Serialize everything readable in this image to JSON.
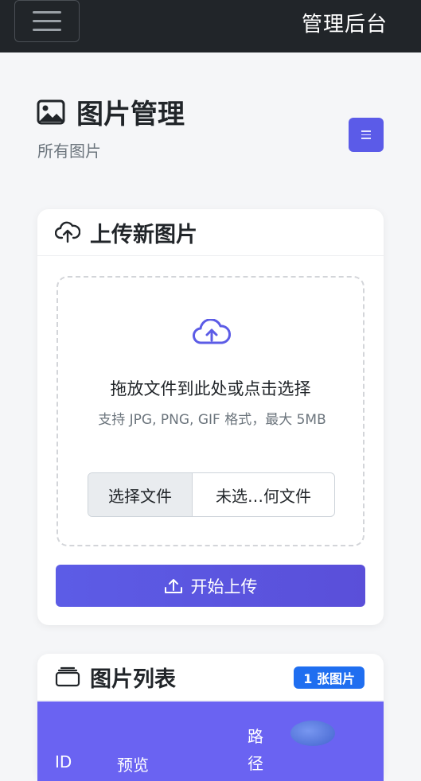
{
  "navbar": {
    "brand": "管理后台"
  },
  "header": {
    "title": "图片管理",
    "subtitle": "所有图片"
  },
  "upload_card": {
    "title": "上传新图片",
    "dropzone_title": "拖放文件到此处或点击选择",
    "dropzone_hint": "支持 JPG, PNG, GIF 格式，最大 5MB",
    "choose_file_label": "选择文件",
    "file_status": "未选…何文件",
    "upload_button": "开始上传"
  },
  "list_card": {
    "title": "图片列表",
    "count_badge": "1 张图片",
    "columns": [
      "ID",
      "预览",
      "路径"
    ]
  },
  "colors": {
    "accent": "#5c5ce6",
    "navbar": "#212529",
    "badge": "#1f6ef0"
  },
  "icons": [
    "menu-icon",
    "image-icon",
    "list-icon",
    "cloud-upload-icon",
    "upload-icon",
    "tray-icon"
  ]
}
